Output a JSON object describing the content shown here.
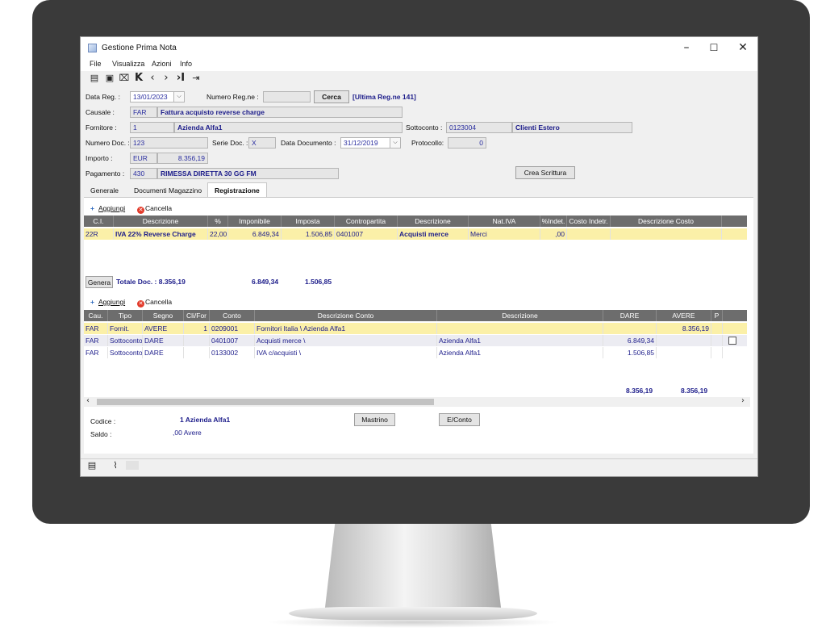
{
  "window": {
    "title": "Gestione Prima Nota",
    "minimize": "–",
    "maximize": "☐",
    "close": "✕"
  },
  "menu": [
    "File",
    "Visualizza",
    "Azioni",
    "Info"
  ],
  "header": {
    "data_reg_label": "Data Reg. :",
    "data_reg_value": "13/01/2023",
    "numero_regne_label": "Numero Reg.ne :",
    "numero_regne_value": "",
    "cerca_button": "Cerca",
    "ultima_reg": "[Ultima Reg.ne  141]",
    "causale_label": "Causale :",
    "causale_code": "FAR",
    "causale_desc": "Fattura acquisto reverse charge",
    "fornitore_label": "Fornitore :",
    "fornitore_code": "1",
    "fornitore_name": "Azienda Alfa1",
    "sottoconto_label": "Sottoconto :",
    "sottoconto_code": "0123004",
    "sottoconto_desc": "Clienti Estero",
    "numero_doc_label": "Numero Doc. :",
    "numero_doc_value": "123",
    "serie_doc_label": "Serie Doc. :",
    "serie_doc_value": "X",
    "data_documento_label": "Data Documento :",
    "data_documento_value": "31/12/2019",
    "protocollo_label": "Protocollo:",
    "protocollo_value": "0",
    "importo_label": "Importo :",
    "importo_currency": "EUR",
    "importo_value": "8.356,19",
    "pagamento_label": "Pagamento :",
    "pagamento_code": "430",
    "pagamento_desc": "RIMESSA DIRETTA 30 GG FM",
    "crea_scrittura_button": "Crea Scrittura"
  },
  "tabs": [
    {
      "label": "Generale"
    },
    {
      "label": "Documenti Magazzino"
    },
    {
      "label": "Registrazione"
    }
  ],
  "iva_section": {
    "add_label": "Aggiungi",
    "delete_label": "Cancella",
    "columns": [
      "C.I.",
      "Descrizione",
      "%",
      "Imponibile",
      "Imposta",
      "Contropartita",
      "Descrizione",
      "Nat.IVA",
      "%Indet.",
      "Costo Indetr.",
      "Descrizione Costo"
    ],
    "rows": [
      [
        "22R",
        "IVA 22% Reverse Charge",
        "22,00",
        "6.849,34",
        "1.506,85",
        "0401007",
        "Acquisti merce",
        "Merci",
        ",00",
        "",
        ""
      ]
    ],
    "genera_button": "Genera",
    "totale_doc": "Totale Doc. : 8.356,19",
    "total_imponibile": "6.849,34",
    "total_imposta": "1.506,85"
  },
  "movements_section": {
    "add_label": "Aggiungi",
    "delete_label": "Cancella",
    "columns": [
      "Cau.",
      "Tipo",
      "Segno",
      "Cli/For",
      "Conto",
      "Descrizione Conto",
      "Descrizione",
      "DARE",
      "AVERE",
      "P"
    ],
    "rows": [
      [
        "FAR",
        "Fornit.",
        "AVERE",
        "1",
        "0209001",
        "Fornitori Italia \\ Azienda Alfa1",
        "",
        "",
        "8.356,19",
        ""
      ],
      [
        "FAR",
        "Sottoconto",
        "DARE",
        "",
        "0401007",
        "Acquisti merce \\",
        "Azienda Alfa1",
        "6.849,34",
        "",
        ""
      ],
      [
        "FAR",
        "Sottoconto",
        "DARE",
        "",
        "0133002",
        "IVA c/acquisti \\",
        "Azienda Alfa1",
        "1.506,85",
        "",
        ""
      ]
    ],
    "total_dare": "8.356,19",
    "total_avere": "8.356,19"
  },
  "footer_info": {
    "codice_label": "Codice :",
    "codice_value": "1 Azienda Alfa1",
    "saldo_label": "Saldo :",
    "saldo_value": ",00 Avere",
    "mastrino_button": "Mastrino",
    "econto_button": "E/Conto"
  },
  "colors": {
    "bezel": "#3a3a3a",
    "grid_header": "#6d6d6d",
    "highlight_row": "#fbf0a8",
    "value_text": "#1c1c8a"
  },
  "icons": [
    "new-doc-icon",
    "save-icon",
    "delete-icon",
    "first-icon",
    "prev-icon",
    "next-icon",
    "last-icon",
    "exit-icon",
    "notes-icon",
    "attachment-icon"
  ]
}
